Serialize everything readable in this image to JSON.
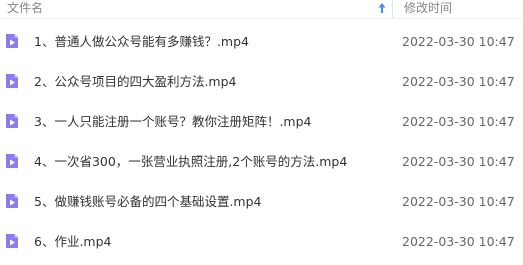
{
  "header": {
    "name_label": "文件名",
    "time_label": "修改时间",
    "sort_icon": "arrow-up-icon",
    "accent_color": "#3b8cff"
  },
  "file_icon": {
    "icon": "video-file-icon",
    "color": "#8a7cf0"
  },
  "files": [
    {
      "name": "1、普通人做公众号能有多赚钱？.mp4",
      "modified": "2022-03-30 10:47"
    },
    {
      "name": "2、公众号项目的四大盈利方法.mp4",
      "modified": "2022-03-30 10:47"
    },
    {
      "name": "3、一人只能注册一个账号？教你注册矩阵！.mp4",
      "modified": "2022-03-30 10:47"
    },
    {
      "name": "4、一次省300，一张营业执照注册,2个账号的方法.mp4",
      "modified": "2022-03-30 10:47"
    },
    {
      "name": "5、做赚钱账号必备的四个基础设置.mp4",
      "modified": "2022-03-30 10:47"
    },
    {
      "name": "6、作业.mp4",
      "modified": "2022-03-30 10:47"
    }
  ]
}
